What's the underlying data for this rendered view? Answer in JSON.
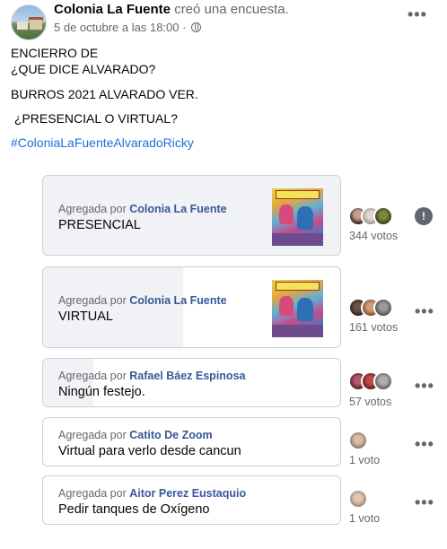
{
  "header": {
    "page_name": "Colonia La Fuente",
    "action": "creó una encuesta.",
    "timestamp": "5 de octubre a las 18:00 ·",
    "privacy_icon": "globe-icon",
    "more_icon": "more-options-icon"
  },
  "post": {
    "lines": [
      "ENCIERRO DE",
      "¿QUE DICE ALVARADO?",
      "BURROS 2021 ALVARADO VER.",
      " ¿PRESENCIAL O VIRTUAL?"
    ],
    "hashtag": "#ColoniaLaFuenteAlvaradoRicky"
  },
  "poll": {
    "added_by_prefix": "Agregada por",
    "options": [
      {
        "author": "Colonia La Fuente",
        "label": "PRESENCIAL",
        "votes": "344 votos",
        "share": 1.0,
        "has_image": true,
        "action_icon": "info-icon"
      },
      {
        "author": "Colonia La Fuente",
        "label": "VIRTUAL",
        "votes": "161 votos",
        "share": 0.47,
        "has_image": true,
        "action_icon": "more-options-icon"
      },
      {
        "author": "Rafael Báez Espinosa",
        "label": "Ningún festejo.",
        "votes": "57 votos",
        "share": 0.17,
        "has_image": false,
        "action_icon": "more-options-icon"
      },
      {
        "author": "Catito De Zoom",
        "label": "Virtual para verlo desde cancun",
        "votes": "1 voto",
        "share": 0.003,
        "has_image": false,
        "action_icon": "more-options-icon"
      },
      {
        "author": "Aitor Perez Eustaquio",
        "label": "Pedir tanques de Oxígeno",
        "votes": "1 voto",
        "share": 0.003,
        "has_image": false,
        "action_icon": "more-options-icon"
      }
    ]
  },
  "colors": {
    "link_blue": "#216fdb",
    "author_blue": "#385898",
    "secondary_text": "#65676b",
    "result_fill": "#f0f2f5",
    "border": "#ccd0d5"
  }
}
